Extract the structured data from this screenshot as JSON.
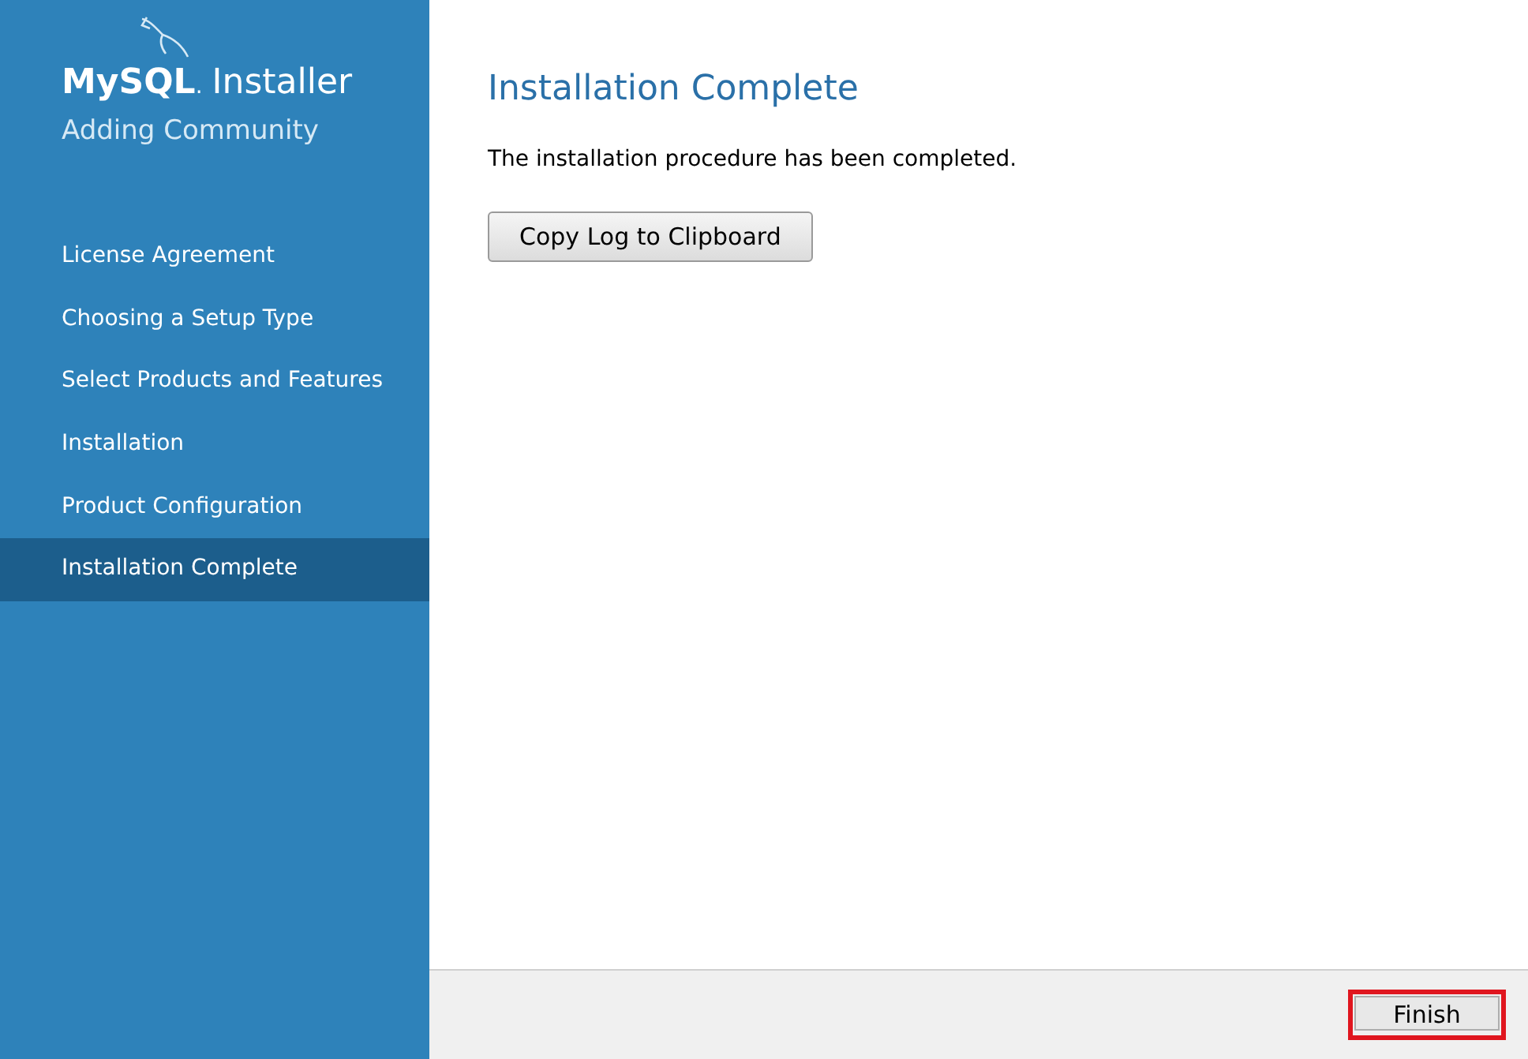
{
  "sidebar": {
    "logo_text": "MySQL",
    "logo_dot": ".",
    "product": "Installer",
    "subtitle": "Adding Community",
    "steps": [
      {
        "label": "License Agreement",
        "selected": false
      },
      {
        "label": "Choosing a Setup Type",
        "selected": false
      },
      {
        "label": "Select Products and Features",
        "selected": false
      },
      {
        "label": "Installation",
        "selected": false
      },
      {
        "label": "Product Configuration",
        "selected": false
      },
      {
        "label": "Installation Complete",
        "selected": true
      }
    ]
  },
  "content": {
    "title": "Installation Complete",
    "message": "The installation procedure has been completed.",
    "copy_button": "Copy Log to Clipboard"
  },
  "footer": {
    "buttons": [
      {
        "label": "Finish",
        "highlighted": true
      }
    ]
  }
}
